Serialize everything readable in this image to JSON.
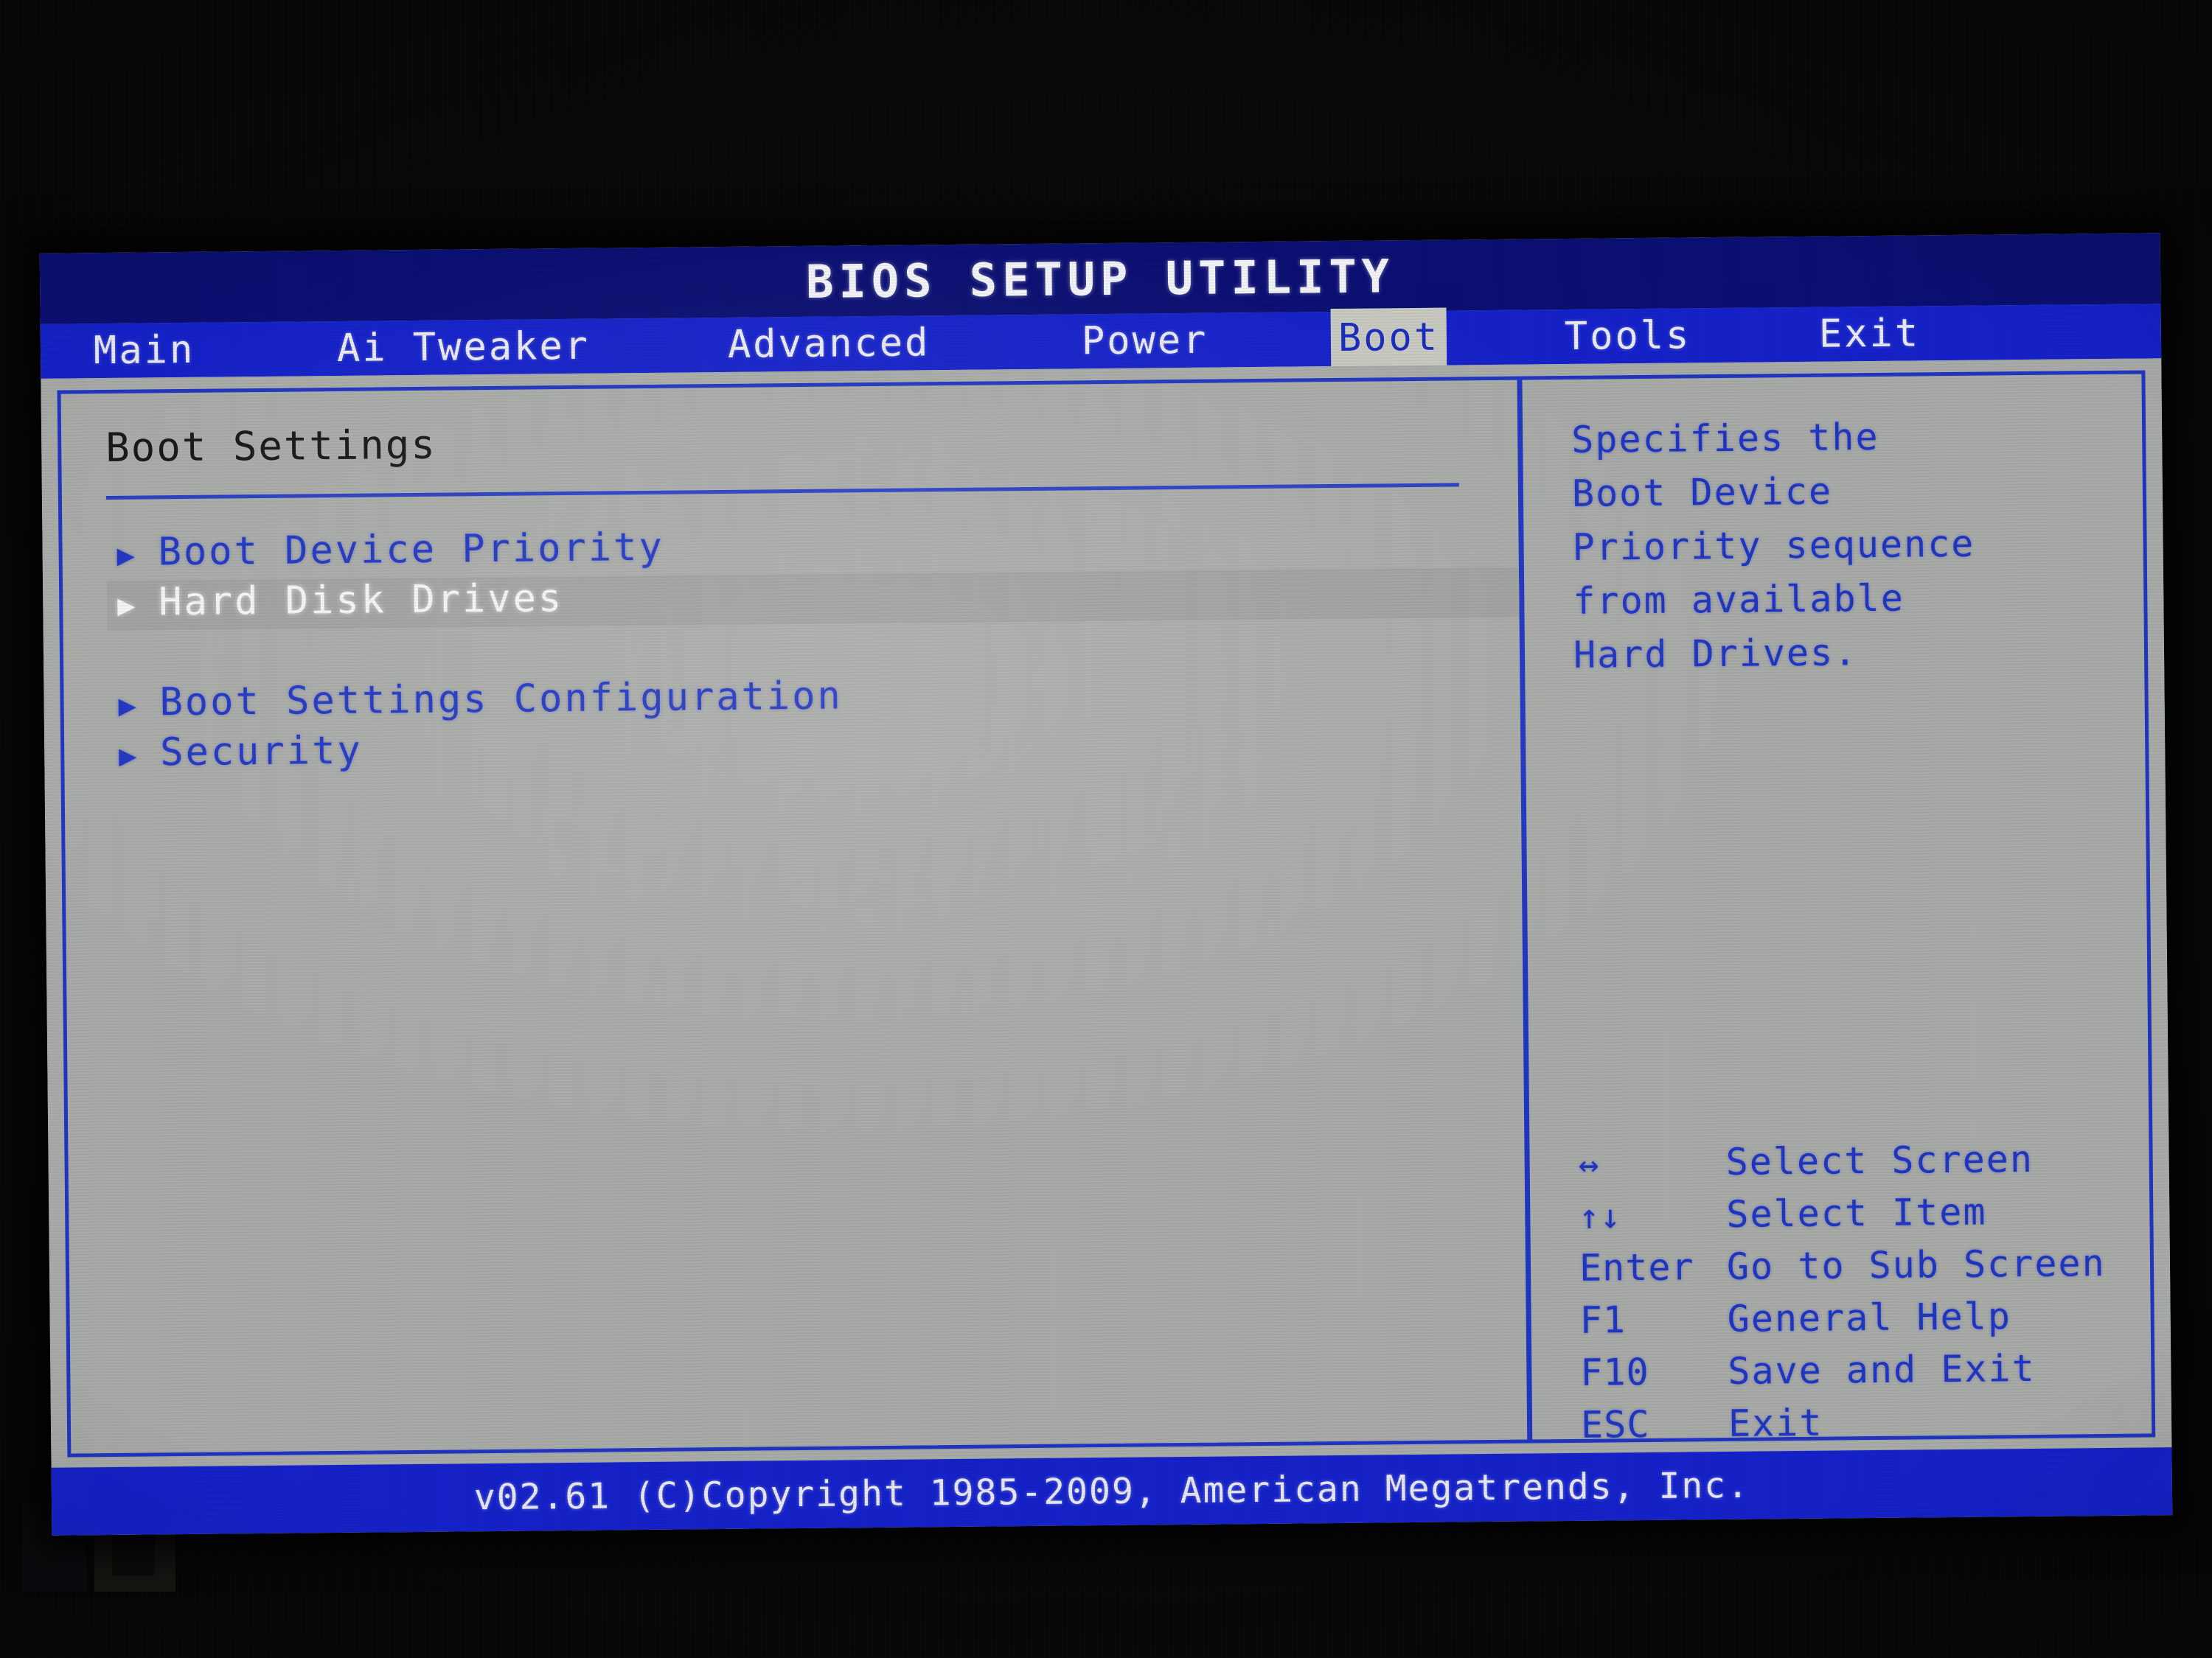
{
  "window": {
    "title": "BIOS SETUP UTILITY"
  },
  "menubar": {
    "tabs": [
      {
        "label": "Main",
        "active": false
      },
      {
        "label": "Ai Tweaker",
        "active": false
      },
      {
        "label": "Advanced",
        "active": false
      },
      {
        "label": "Power",
        "active": false
      },
      {
        "label": "Boot",
        "active": true
      },
      {
        "label": "Tools",
        "active": false
      },
      {
        "label": "Exit",
        "active": false
      }
    ]
  },
  "left_panel": {
    "section_title": "Boot Settings",
    "items": [
      {
        "arrow": "▶",
        "label": "Boot Device Priority",
        "selected": false,
        "spacer": false
      },
      {
        "arrow": "▶",
        "label": "Hard Disk Drives",
        "selected": true,
        "spacer": false
      },
      {
        "arrow": "",
        "label": "",
        "selected": false,
        "spacer": true
      },
      {
        "arrow": "▶",
        "label": "Boot Settings Configuration",
        "selected": false,
        "spacer": false
      },
      {
        "arrow": "▶",
        "label": "Security",
        "selected": false,
        "spacer": false
      }
    ]
  },
  "right_panel": {
    "help_lines": [
      "Specifies the",
      "Boot Device",
      "Priority sequence",
      "from available",
      "Hard Drives."
    ],
    "legend": [
      {
        "key": "↔",
        "desc": "Select Screen",
        "glyph": true
      },
      {
        "key": "↑↓",
        "desc": "Select Item",
        "glyph": true
      },
      {
        "key": "Enter",
        "desc": "Go to Sub Screen",
        "glyph": false
      },
      {
        "key": "F1",
        "desc": "General Help",
        "glyph": false
      },
      {
        "key": "F10",
        "desc": "Save and Exit",
        "glyph": false
      },
      {
        "key": "ESC",
        "desc": "Exit",
        "glyph": false
      }
    ]
  },
  "footer": {
    "text": "v02.61  (C)Copyright 1985-2009, American Megatrends, Inc."
  },
  "colors": {
    "title_bar_blue": "#0b0f72",
    "menu_bar_blue": "#1522c9",
    "body_gray": "#a9aba8",
    "accent_blue": "#2036c2",
    "active_tab_bg": "#c8c9c0",
    "selected_row_bg": "#9fa29f",
    "text_white": "#f2f3f6",
    "heading_dark": "#17181c"
  }
}
